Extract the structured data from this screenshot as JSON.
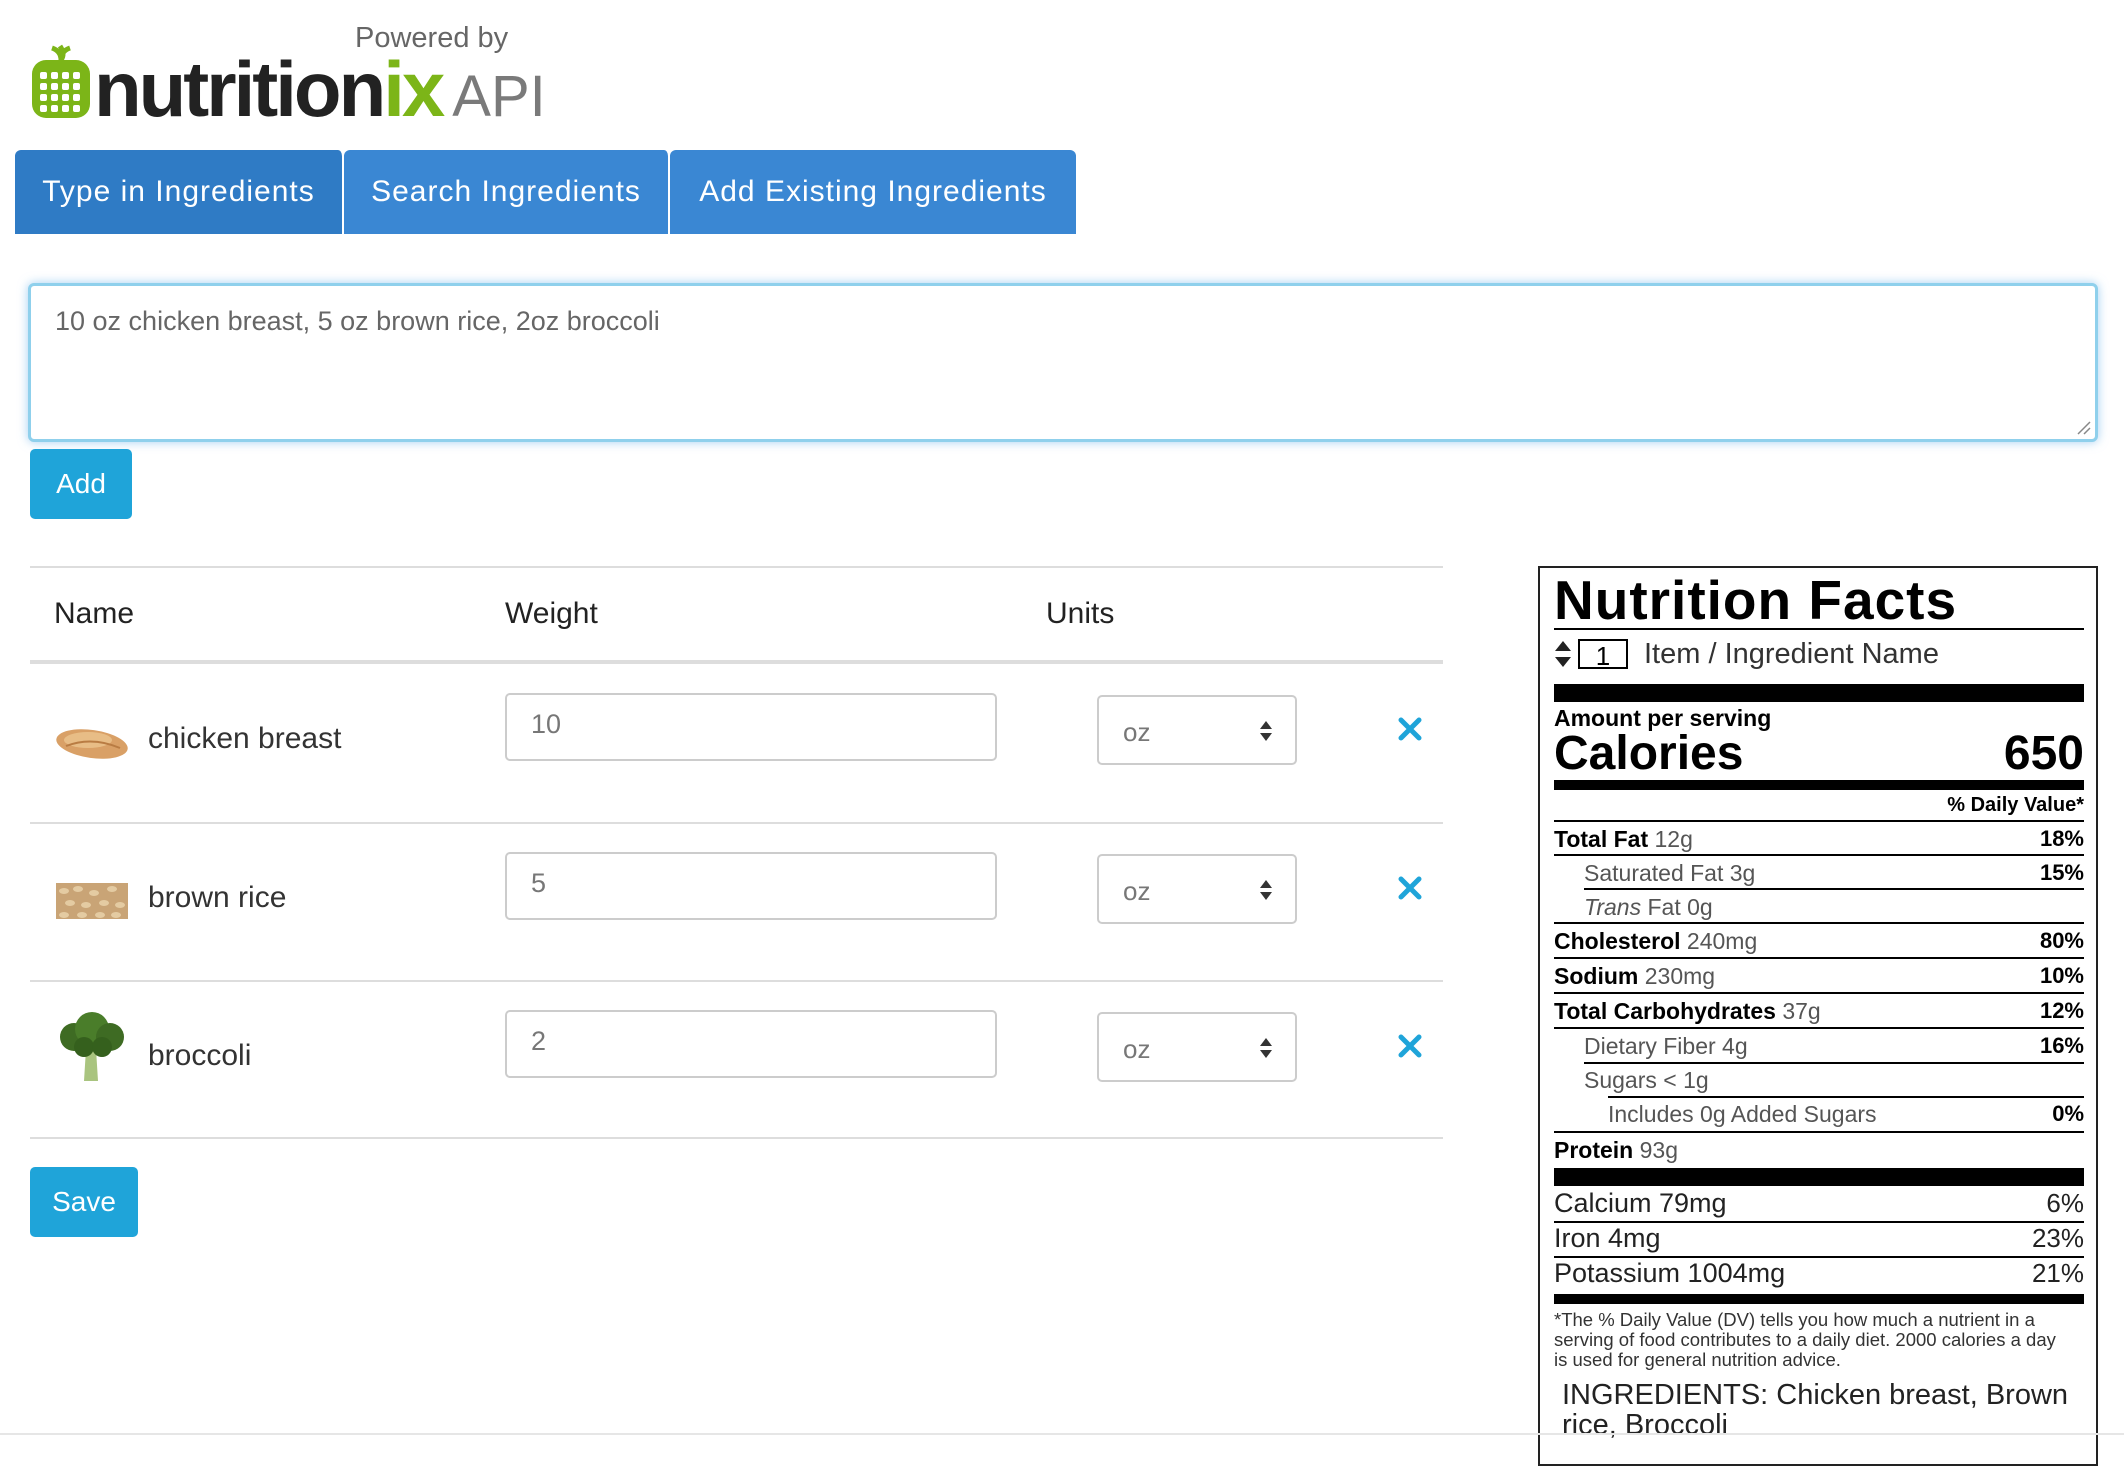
{
  "logo": {
    "powered_by": "Powered by",
    "brand_main": "nutrition",
    "brand_ix": "ix",
    "brand_api": "API",
    "brand_color": "#7cb518"
  },
  "tabs": [
    {
      "label": "Type in Ingredients"
    },
    {
      "label": "Search Ingredients"
    },
    {
      "label": "Add Existing Ingredients"
    }
  ],
  "query": {
    "value": "10 oz chicken breast, 5 oz brown rice, 2oz broccoli"
  },
  "buttons": {
    "add_label": "Add",
    "save_label": "Save",
    "accent": "#1fa4d9"
  },
  "table": {
    "headers": {
      "name": "Name",
      "weight": "Weight",
      "units": "Units"
    },
    "rows": [
      {
        "name": "chicken breast",
        "weight": "10",
        "unit": "oz",
        "thumb_icon": "chicken-breast-image"
      },
      {
        "name": "brown rice",
        "weight": "5",
        "unit": "oz",
        "thumb_icon": "brown-rice-image"
      },
      {
        "name": "broccoli",
        "weight": "2",
        "unit": "oz",
        "thumb_icon": "broccoli-image"
      }
    ]
  },
  "nutrition": {
    "title": "Nutrition Facts",
    "servings": "1",
    "item_label": "Item / Ingredient Name",
    "amount_per_serving": "Amount per serving",
    "calories_label": "Calories",
    "calories": "650",
    "daily_value_header": "% Daily Value*",
    "total_fat": {
      "label": "Total Fat",
      "amount": "12g",
      "dv": "18%"
    },
    "saturated_fat": {
      "label": "Saturated Fat",
      "amount": "3g",
      "dv": "15%"
    },
    "trans_fat": {
      "label_italic": "Trans",
      "label": "Fat",
      "amount": "0g"
    },
    "cholesterol": {
      "label": "Cholesterol",
      "amount": "240mg",
      "dv": "80%"
    },
    "sodium": {
      "label": "Sodium",
      "amount": "230mg",
      "dv": "10%"
    },
    "total_carbs": {
      "label": "Total Carbohydrates",
      "amount": "37g",
      "dv": "12%"
    },
    "fiber": {
      "label": "Dietary Fiber",
      "amount": "4g",
      "dv": "16%"
    },
    "sugars": {
      "label": "Sugars",
      "amount": "< 1g"
    },
    "added_sugars": {
      "label": "Includes 0g Added Sugars",
      "dv": "0%"
    },
    "protein": {
      "label": "Protein",
      "amount": "93g"
    },
    "calcium": {
      "label": "Calcium 79mg",
      "dv": "6%"
    },
    "iron": {
      "label": "Iron 4mg",
      "dv": "23%"
    },
    "potassium": {
      "label": "Potassium 1004mg",
      "dv": "21%"
    },
    "footnote": "*The % Daily Value (DV) tells you how much a nutrient in a serving of food contributes to a daily diet. 2000 calories a day is used for general nutrition advice.",
    "ingredients": "INGREDIENTS: Chicken breast, Brown rice, Broccoli"
  }
}
